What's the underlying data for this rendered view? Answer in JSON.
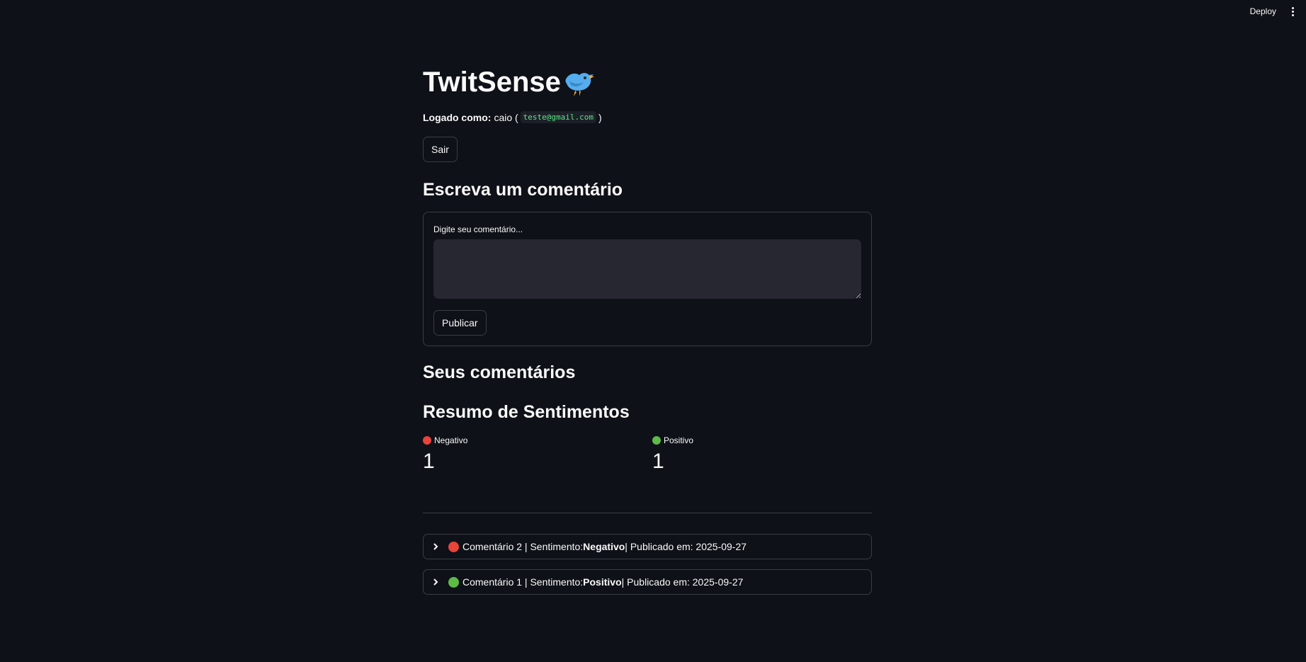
{
  "toolbar": {
    "deploy_label": "Deploy"
  },
  "header": {
    "title": "TwitSense"
  },
  "user": {
    "logged_label": "Logado como:",
    "name_prefix": "caio (",
    "email": "teste@gmail.com",
    "suffix": ")"
  },
  "logout_label": "Sair",
  "compose": {
    "heading": "Escreva um comentário",
    "field_label": "Digite seu comentário...",
    "value": "",
    "publish_label": "Publicar"
  },
  "comments_heading": "Seus comentários",
  "summary": {
    "heading": "Resumo de Sentimentos",
    "negative_label": "Negativo",
    "negative_value": "1",
    "positive_label": "Positivo",
    "positive_value": "1"
  },
  "comments": [
    {
      "prefix": "Comentário 2 | Sentimento: ",
      "sentiment": "Negativo",
      "suffix": " | Publicado em: 2025-09-27"
    },
    {
      "prefix": "Comentário 1 | Sentimento: ",
      "sentiment": "Positivo",
      "suffix": " | Publicado em: 2025-09-27"
    }
  ],
  "colors": {
    "background": "#0e1117",
    "negative": "#e8443a",
    "positive": "#5dbb46",
    "code_text": "#5ce488"
  },
  "icons": [
    "bird-icon",
    "kebab-menu-icon",
    "chevron-right-icon",
    "red-circle-icon",
    "green-circle-icon"
  ]
}
